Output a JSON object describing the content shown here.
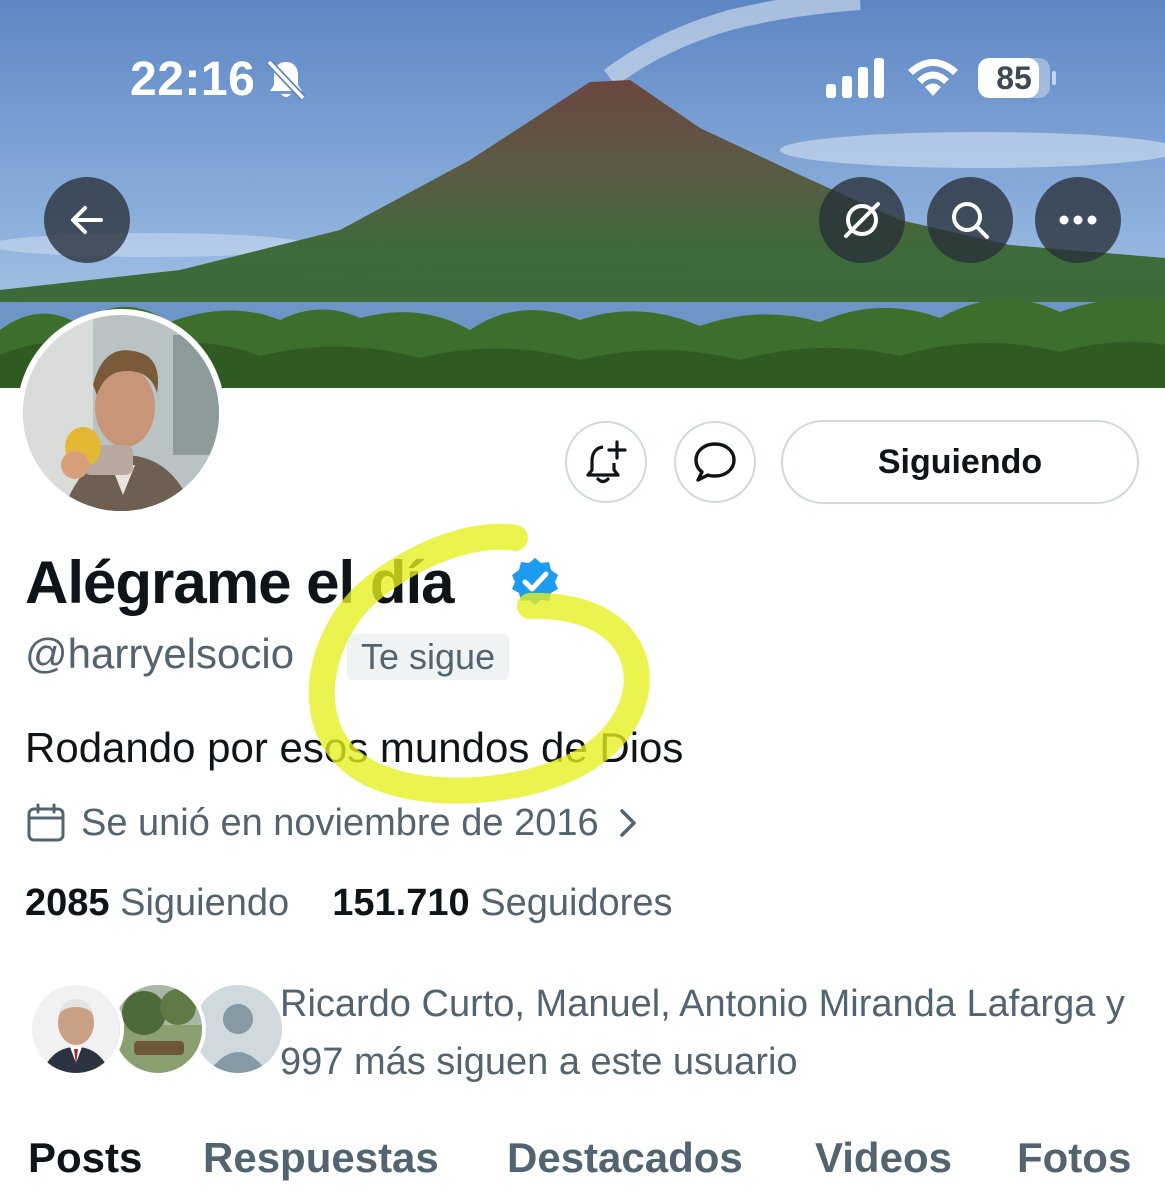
{
  "status_bar": {
    "time": "22:16",
    "battery_level": "85",
    "silent_mode": true
  },
  "header": {
    "back_icon": "arrow-left-icon",
    "actions": [
      "grok-icon",
      "search-icon",
      "more-icon"
    ]
  },
  "profile": {
    "display_name": "Alégrame el día",
    "verified": true,
    "handle": "@harryelsocio",
    "follows_you_label": "Te sigue",
    "bio": "Rodando por esos mundos de Dios",
    "joined": "Se unió en noviembre de 2016",
    "following_count": "2085",
    "following_label": "Siguiendo",
    "followers_count": "151.710",
    "followers_label": "Seguidores"
  },
  "actions": {
    "notify_icon": "bell-plus-icon",
    "message_icon": "chat-bubble-icon",
    "follow_button_label": "Siguiendo"
  },
  "followers_you_know": {
    "text": "Ricardo Curto, Manuel, Antonio Miranda Lafarga y 997 más siguen a este usuario"
  },
  "tabs": [
    {
      "label": "Posts",
      "active": true
    },
    {
      "label": "Respuestas",
      "active": false
    },
    {
      "label": "Destacados",
      "active": false
    },
    {
      "label": "Videos",
      "active": false
    },
    {
      "label": "Fotos",
      "active": false
    }
  ],
  "colors": {
    "verified_blue": "#1d9bf0",
    "highlight_yellow": "#e6f01e",
    "secondary_text": "#536471"
  }
}
